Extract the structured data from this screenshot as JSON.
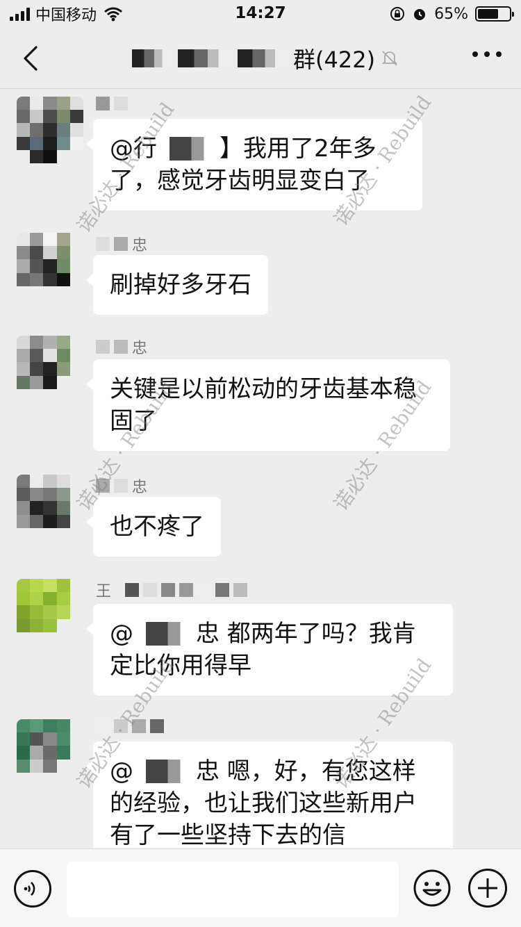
{
  "status_bar": {
    "carrier": "中国移动",
    "time": "14:27",
    "battery": "65%",
    "battery_level": 0.65
  },
  "header": {
    "title_suffix": "群(422)",
    "icons": [
      "back-icon",
      "mute-bell-icon",
      "more-icon"
    ]
  },
  "messages": [
    {
      "sender": "",
      "text_prefix": "@行",
      "text": "】我用了2年多了，感觉牙齿明显变白了"
    },
    {
      "sender": "忠",
      "text_prefix": "",
      "text": "刷掉好多牙石"
    },
    {
      "sender": "忠",
      "text_prefix": "",
      "text": "关键是以前松动的牙齿基本稳固了"
    },
    {
      "sender": "忠",
      "text_prefix": "",
      "text": "也不疼了"
    },
    {
      "sender": "王",
      "text_prefix": "@",
      "text": "忠 都两年了吗？我肯定比你用得早"
    },
    {
      "sender": "",
      "text_prefix": "@",
      "text": "忠 嗯，好，有您这样的经验，也让我们这些新用户有了一些坚持下去的信"
    }
  ],
  "watermark": "诺必达 · Rebuild",
  "input_bar": {
    "placeholder": "",
    "icons": [
      "voice-icon",
      "emoji-icon",
      "add-icon"
    ]
  },
  "colors": {
    "background": "#ededed",
    "bubble": "#ffffff",
    "text": "#111111"
  }
}
